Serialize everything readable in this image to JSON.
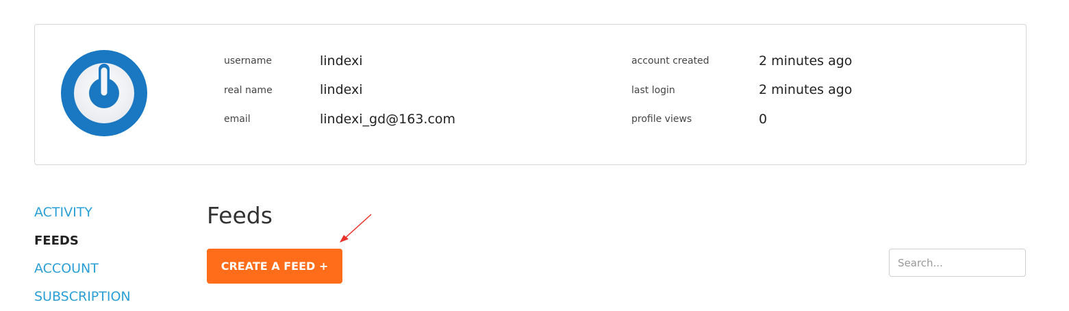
{
  "profile": {
    "avatar_icon": "power-logo-icon",
    "left_fields": [
      {
        "label": "username",
        "value": "lindexi"
      },
      {
        "label": "real name",
        "value": "lindexi"
      },
      {
        "label": "email",
        "value": "lindexi_gd@163.com"
      }
    ],
    "right_fields": [
      {
        "label": "account created",
        "value": "2 minutes ago"
      },
      {
        "label": "last login",
        "value": "2 minutes ago"
      },
      {
        "label": "profile views",
        "value": "0"
      }
    ]
  },
  "nav": {
    "items": [
      {
        "label": "ACTIVITY",
        "active": false
      },
      {
        "label": "FEEDS",
        "active": true
      },
      {
        "label": "ACCOUNT",
        "active": false
      },
      {
        "label": "SUBSCRIPTION",
        "active": false
      }
    ]
  },
  "main": {
    "title": "Feeds",
    "create_button_label": "CREATE A FEED +",
    "search_placeholder": "Search..."
  },
  "colors": {
    "accent_orange": "#ff6d1a",
    "link_blue": "#2a9fd6",
    "avatar_blue": "#1a78c2",
    "annotation_red": "#e8302a"
  }
}
